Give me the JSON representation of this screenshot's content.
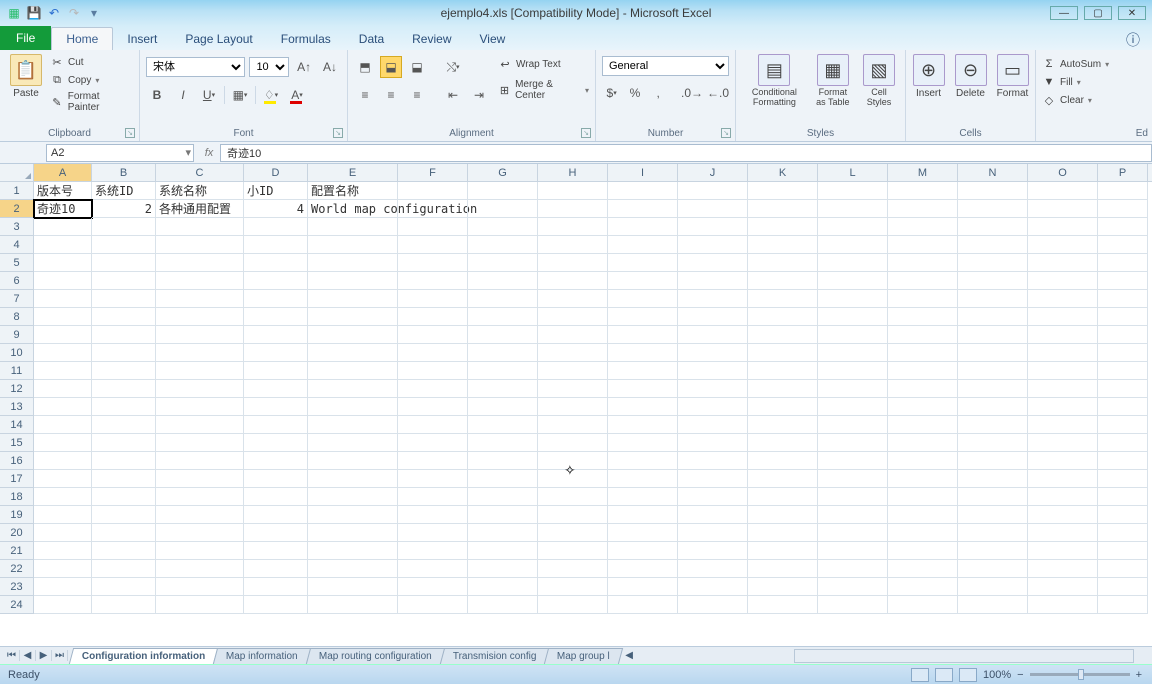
{
  "window": {
    "title": "ejemplo4.xls  [Compatibility Mode] - Microsoft Excel"
  },
  "tabs": {
    "file": "File",
    "home": "Home",
    "insert": "Insert",
    "pagelayout": "Page Layout",
    "formulas": "Formulas",
    "data": "Data",
    "review": "Review",
    "view": "View"
  },
  "clipboard": {
    "paste": "Paste",
    "cut": "Cut",
    "copy": "Copy",
    "fp": "Format Painter",
    "label": "Clipboard"
  },
  "font": {
    "name": "宋体",
    "size": "10",
    "label": "Font"
  },
  "alignment": {
    "wrap": "Wrap Text",
    "merge": "Merge & Center",
    "label": "Alignment"
  },
  "number": {
    "format": "General",
    "label": "Number"
  },
  "styles": {
    "cf": "Conditional Formatting",
    "fat": "Format as Table",
    "cs": "Cell Styles",
    "label": "Styles"
  },
  "cells": {
    "insert": "Insert",
    "delete": "Delete",
    "format": "Format",
    "label": "Cells"
  },
  "editing": {
    "autosum": "AutoSum",
    "fill": "Fill",
    "clear": "Clear",
    "label": "Ed"
  },
  "namebox": "A2",
  "formula": "奇迹10",
  "columns": [
    "A",
    "B",
    "C",
    "D",
    "E",
    "F",
    "G",
    "H",
    "I",
    "J",
    "K",
    "L",
    "M",
    "N",
    "O",
    "P"
  ],
  "headers": {
    "A": "版本号",
    "B": "系统ID",
    "C": "系统名称",
    "D": "小ID",
    "E": "配置名称"
  },
  "row2": {
    "A": "奇迹10",
    "B": "2",
    "C": "各种通用配置",
    "D": "4",
    "E": "World map configuration"
  },
  "sheetTabs": [
    "Configuration information",
    "Map information",
    "Map routing configuration",
    "Transmision config",
    "Map group l"
  ],
  "status": {
    "ready": "Ready",
    "zoom": "100%"
  }
}
